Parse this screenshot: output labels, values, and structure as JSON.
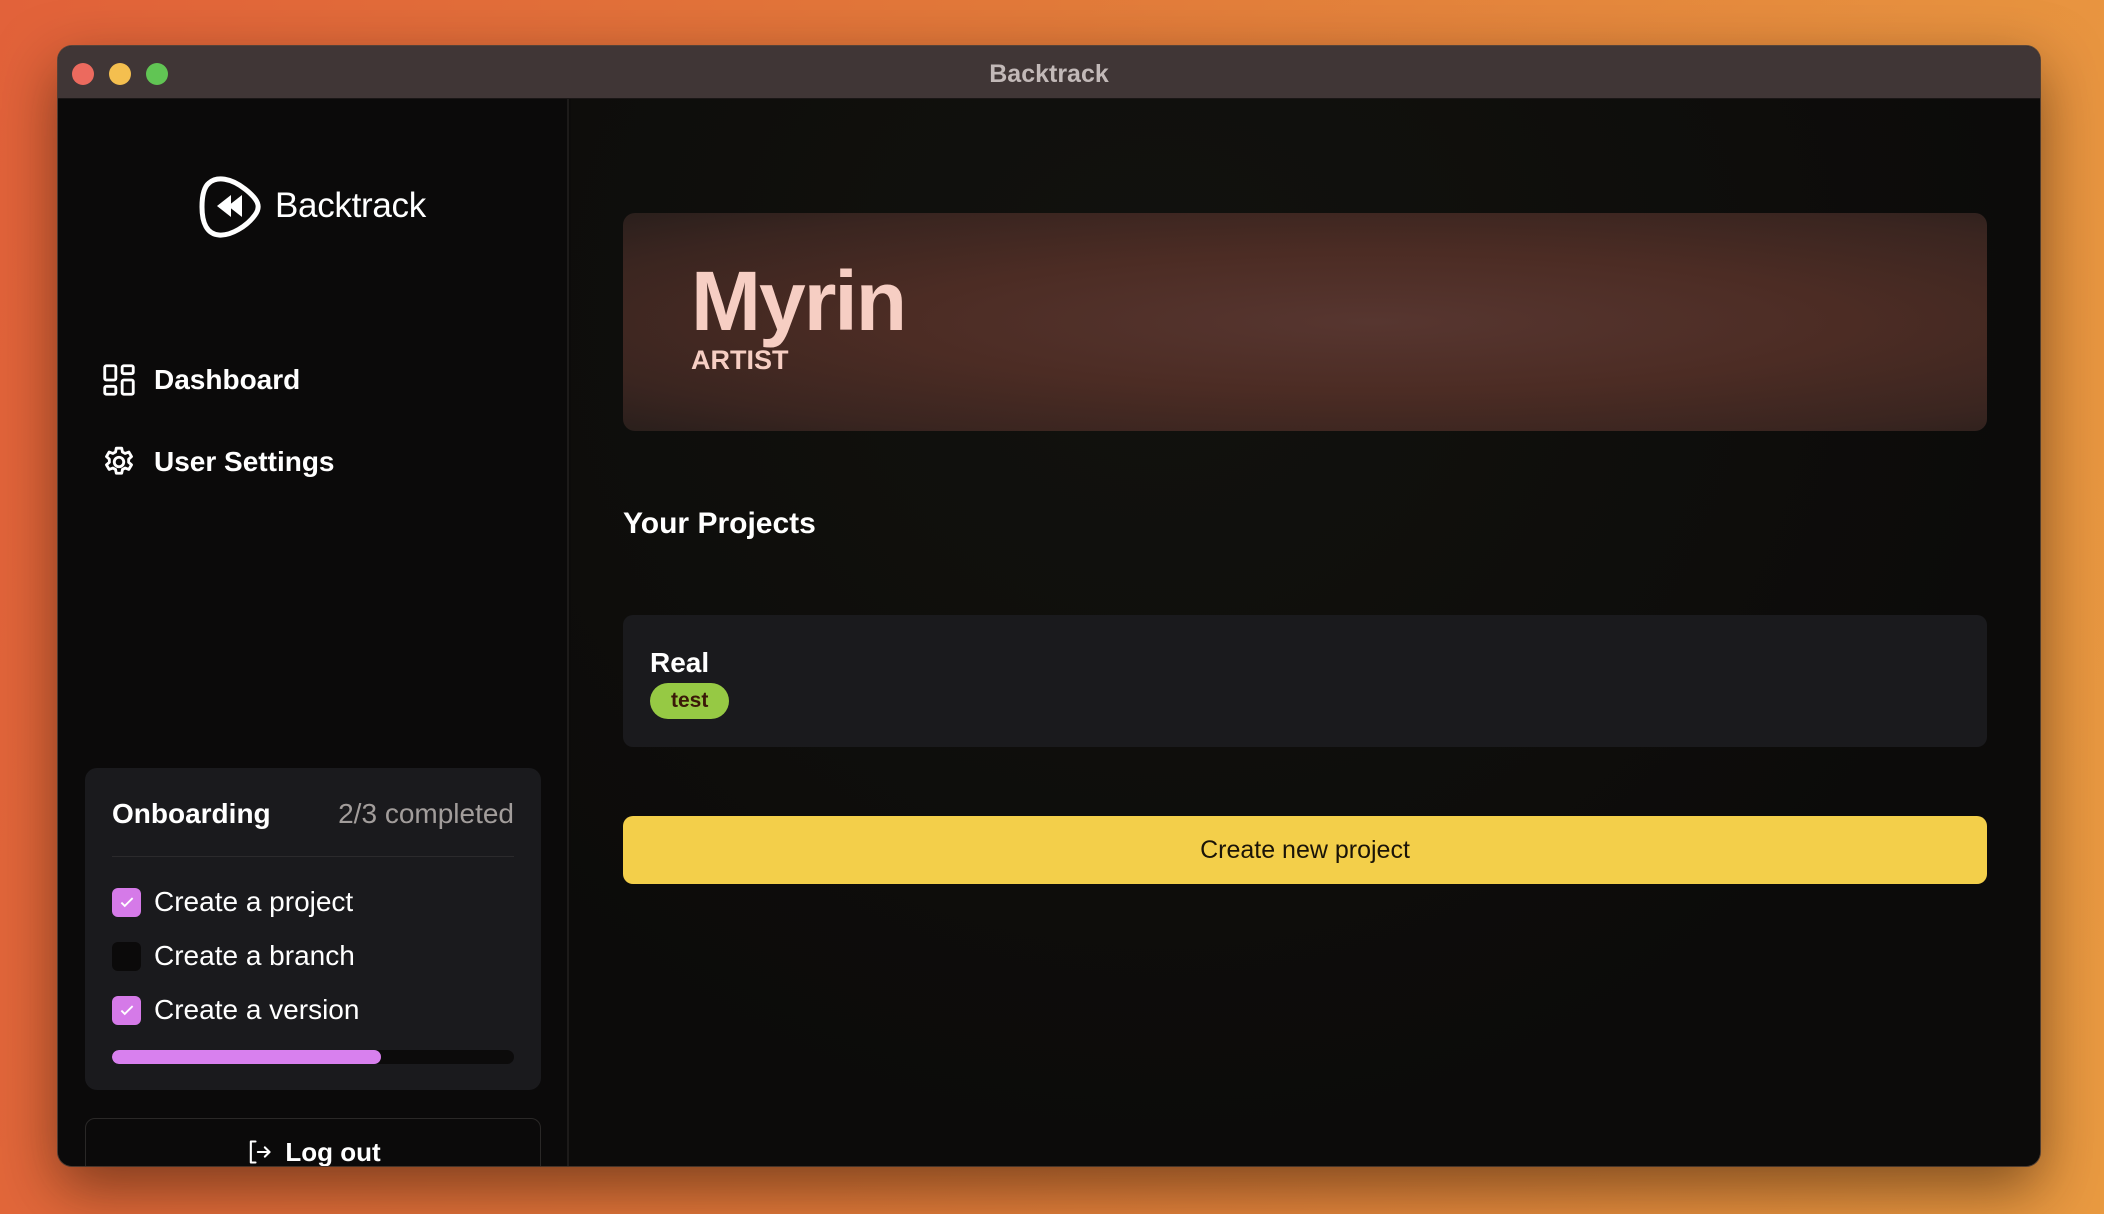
{
  "window": {
    "title": "Backtrack"
  },
  "sidebar": {
    "logo_text": "Backtrack",
    "nav": [
      {
        "label": "Dashboard",
        "icon": "dashboard-grid-icon"
      },
      {
        "label": "User Settings",
        "icon": "gear-icon"
      }
    ],
    "onboarding": {
      "title": "Onboarding",
      "count_text": "2/3 completed",
      "progress_fraction": 0.67,
      "items": [
        {
          "label": "Create a project",
          "checked": true
        },
        {
          "label": "Create a branch",
          "checked": false
        },
        {
          "label": "Create a version",
          "checked": true
        }
      ]
    },
    "logout_label": "Log out"
  },
  "main": {
    "profile": {
      "name": "Myrin",
      "role": "ARTIST"
    },
    "projects_title": "Your Projects",
    "projects": [
      {
        "name": "Real",
        "tag": "test"
      }
    ],
    "create_button_label": "Create new project"
  },
  "colors": {
    "accent_purple": "#d880ee",
    "tag_green": "#96c944",
    "button_yellow": "#f3cf4a",
    "hero_text": "#f6cec3"
  }
}
